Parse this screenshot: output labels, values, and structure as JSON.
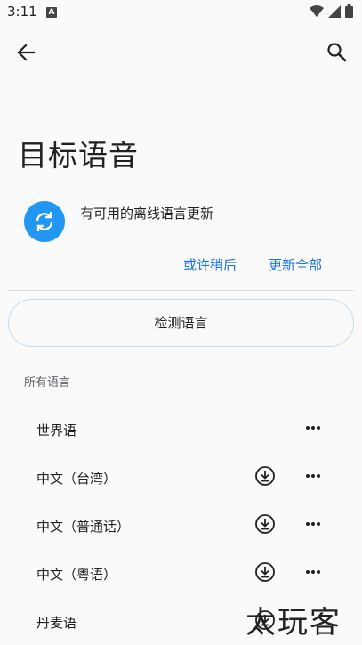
{
  "status_bar": {
    "time": "3:11",
    "notification_letter": "A"
  },
  "toolbar": {
    "back_icon": "arrow-left-icon",
    "search_icon": "search-icon"
  },
  "page": {
    "title": "目标语音"
  },
  "update_banner": {
    "icon": "sync-icon",
    "accent_color": "#2196f3",
    "message": "有可用的离线语言更新",
    "later_label": "或许稍后",
    "update_all_label": "更新全部"
  },
  "detect_button": {
    "label": "检测语言"
  },
  "all_languages": {
    "header": "所有语言",
    "items": [
      {
        "label": "世界语",
        "downloadable": false
      },
      {
        "label": "中文（台湾）",
        "downloadable": true
      },
      {
        "label": "中文（普通话）",
        "downloadable": true
      },
      {
        "label": "中文（粤语）",
        "downloadable": true
      },
      {
        "label": "丹麦语",
        "downloadable": true
      }
    ]
  },
  "watermark": {
    "text": "太玩客"
  },
  "colors": {
    "link": "#1a73e8",
    "background": "#fafafa"
  }
}
